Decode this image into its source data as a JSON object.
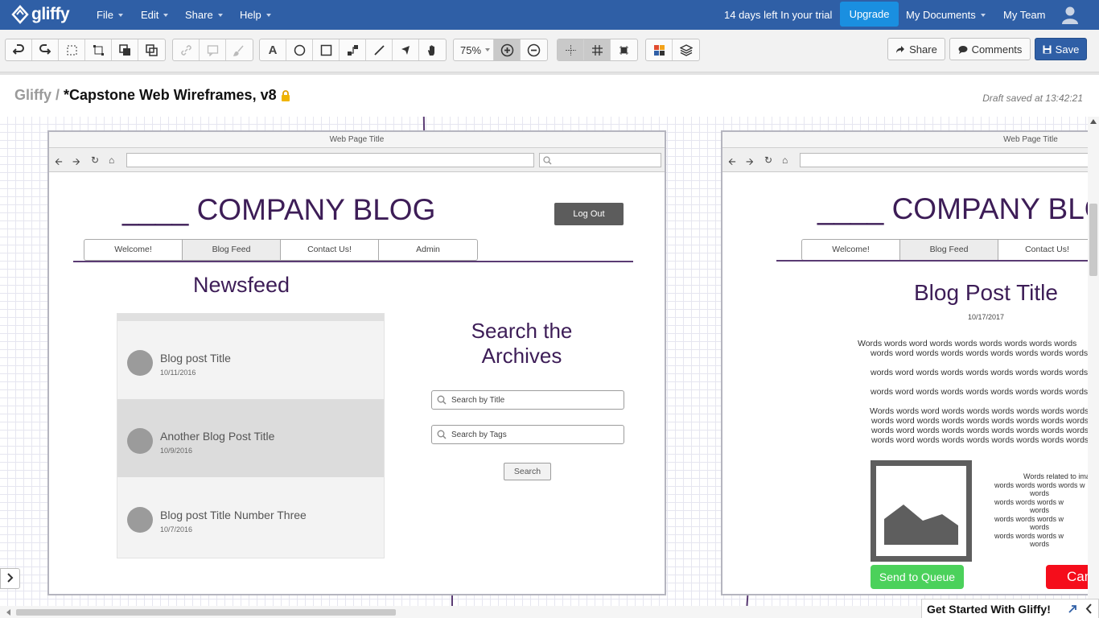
{
  "app": {
    "brand": "gliffy",
    "brand_color": "#2f5fa6"
  },
  "menu": [
    {
      "label": "File"
    },
    {
      "label": "Edit"
    },
    {
      "label": "Share"
    },
    {
      "label": "Help"
    }
  ],
  "header_right": {
    "trial_text": "14 days left In your trial",
    "upgrade_label": "Upgrade",
    "my_documents": "My Documents",
    "my_team": "My Team"
  },
  "toolbar": {
    "zoom_value": "75%",
    "share_label": "Share",
    "comments_label": "Comments",
    "save_label": "Save",
    "text_tool": "A"
  },
  "document": {
    "breadcrumb": "Gliffy /",
    "title": "*Capstone Web Wireframes, v8",
    "draft_status": "Draft saved at 13:42:21"
  },
  "wireframe_left": {
    "page_title": "Web Page Title",
    "company_name": "____ COMPANY BLOG",
    "logout": "Log Out",
    "nav": [
      "Welcome!",
      "Blog Feed",
      "Contact Us!",
      "Admin"
    ],
    "newsfeed_heading": "Newsfeed",
    "posts": [
      {
        "title": "Blog post Title",
        "date": "10/11/2016"
      },
      {
        "title": "Another Blog Post Title",
        "date": "10/9/2016"
      },
      {
        "title": "Blog post Title Number Three",
        "date": "10/7/2016"
      }
    ],
    "search_heading": "Search the Archives",
    "search_title_placeholder": "Search by Title",
    "search_tags_placeholder": "Search by Tags",
    "search_button": "Search"
  },
  "wireframe_right": {
    "page_title": "Web Page Title",
    "company_name": "____ COMPANY BLOG",
    "nav": [
      "Welcome!",
      "Blog Feed",
      "Contact Us!"
    ],
    "post_title": "Blog Post Title",
    "post_date": "10/17/2017",
    "paragraphs": [
      "Words words word words words words words words words",
      "words word words words words words words words words",
      "words word words words words words words words words",
      "words word words words words words words words words",
      "Words words word words words words words words words",
      "words word words words words words words words words",
      "words word words words words words words words words",
      "words word words words words words words words words"
    ],
    "image_caption_lines": [
      "Words related to ima",
      "words words words words w",
      "words",
      "words words words w",
      "words",
      "words words words w",
      "words",
      "words words words w",
      "words"
    ],
    "send_to_queue": "Send to Queue",
    "cancel": "Can"
  },
  "footer": {
    "get_started": "Get Started With Gliffy!"
  }
}
